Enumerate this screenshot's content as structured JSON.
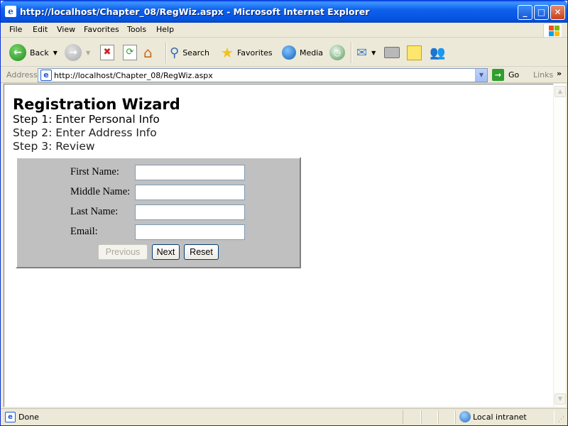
{
  "window": {
    "title": "http://localhost/Chapter_08/RegWiz.aspx - Microsoft Internet Explorer"
  },
  "menu": [
    "File",
    "Edit",
    "View",
    "Favorites",
    "Tools",
    "Help"
  ],
  "toolbar": {
    "back_label": "Back",
    "search_label": "Search",
    "favorites_label": "Favorites",
    "media_label": "Media"
  },
  "address": {
    "label": "Address",
    "url": "http://localhost/Chapter_08/RegWiz.aspx",
    "go_label": "Go",
    "links_label": "Links"
  },
  "page": {
    "title": "Registration Wizard",
    "steps": [
      "Step 1: Enter Personal Info",
      "Step 2: Enter Address Info",
      "Step 3: Review"
    ],
    "form": {
      "fields": [
        {
          "label": "First Name:",
          "value": ""
        },
        {
          "label": "Middle Name:",
          "value": ""
        },
        {
          "label": "Last Name:",
          "value": ""
        },
        {
          "label": "Email:",
          "value": ""
        }
      ],
      "buttons": {
        "previous": "Previous",
        "next": "Next",
        "reset": "Reset"
      }
    }
  },
  "status": {
    "text": "Done",
    "zone": "Local intranet"
  },
  "colors": {
    "titlebar": "#0553e0",
    "form_background": "#c0c0c0"
  }
}
